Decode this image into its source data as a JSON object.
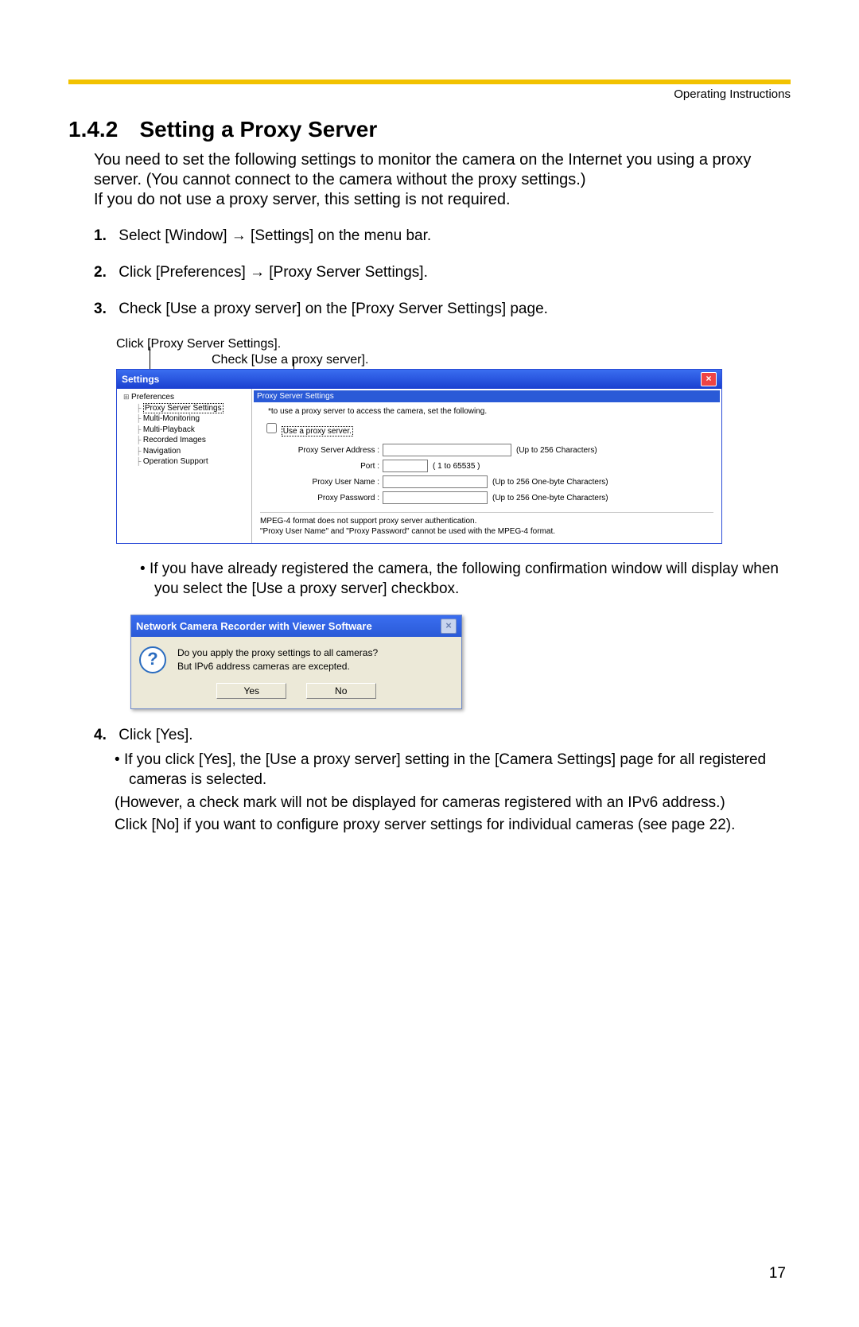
{
  "header": {
    "running_head": "Operating Instructions"
  },
  "section": {
    "number": "1.4.2",
    "title": "Setting a Proxy Server"
  },
  "intro": {
    "p1": "You need to set the following settings to monitor the camera on the Internet you using a proxy server. (You cannot connect to the camera without the proxy settings.)",
    "p2": "If you do not use a proxy server, this setting is not required."
  },
  "steps": {
    "s1_num": "1.",
    "s1": "Select [Window] → [Settings] on the menu bar.",
    "s2_num": "2.",
    "s2": "Click [Preferences] → [Proxy Server Settings].",
    "s3_num": "3.",
    "s3": "Check [Use a proxy server] on the [Proxy Server Settings] page."
  },
  "callouts": {
    "c1": "Click [Proxy Server Settings].",
    "c2": "Check [Use a proxy server]."
  },
  "settings_window": {
    "title": "Settings",
    "close": "×",
    "tree": {
      "root": "Preferences",
      "items": [
        "Proxy Server Settings",
        "Multi-Monitoring",
        "Multi-Playback",
        "Recorded Images",
        "Navigation",
        "Operation Support"
      ]
    },
    "panel": {
      "title": "Proxy Server Settings",
      "hint": "*to use a proxy server to access the camera, set the following.",
      "checkbox_label": "Use a proxy server.",
      "rows": {
        "address_label": "Proxy Server Address :",
        "address_note": "(Up to 256 Characters)",
        "port_label": "Port :",
        "port_note": "( 1 to 65535 )",
        "user_label": "Proxy User Name :",
        "user_note": "(Up to 256 One-byte Characters)",
        "pass_label": "Proxy Password :",
        "pass_note": "(Up to 256 One-byte Characters)"
      },
      "footnote1": "MPEG-4 format does not support proxy server authentication.",
      "footnote2": "\"Proxy User Name\" and \"Proxy Password\" cannot be used with the MPEG-4 format."
    }
  },
  "bullet_after_screenshot": "If you have already registered the camera, the following confirmation window will display when you select the [Use a proxy server] checkbox.",
  "confirm_dialog": {
    "title": "Network Camera Recorder with Viewer Software",
    "close": "×",
    "line1": "Do you apply the proxy settings to all cameras?",
    "line2": "But IPv6 address cameras are excepted.",
    "yes": "Yes",
    "no": "No"
  },
  "step4": {
    "num": "4.",
    "text": "Click [Yes].",
    "b1": "If you click [Yes], the [Use a proxy server] setting in the [Camera Settings] page for all registered cameras is selected.",
    "b1b": "(However, a check mark will not be displayed for cameras registered with an IPv6 address.)",
    "b1c": "Click [No] if you want to configure proxy server settings for individual cameras (see page 22)."
  },
  "page_number": "17"
}
